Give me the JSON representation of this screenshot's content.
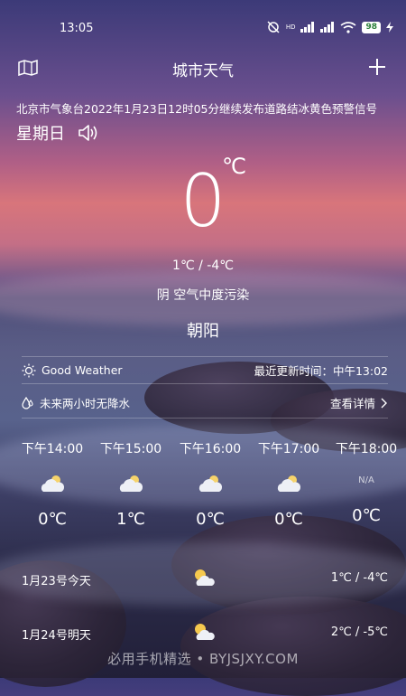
{
  "status_bar": {
    "time": "13:05",
    "network": "HD",
    "battery": "98"
  },
  "nav": {
    "title": "城市天气",
    "map_icon": "map-icon",
    "add_icon": "plus-icon"
  },
  "alert": {
    "text": "北京市气象台2022年1月23日12时05分继续发布道路结冰黄色预警信号"
  },
  "weekday": "星期日",
  "current": {
    "temp": "0",
    "unit": "℃",
    "range": "1℃ / -4℃",
    "condition": "阴  空气中度污染",
    "city": "朝阳"
  },
  "info": {
    "summary": "Good Weather",
    "updated": "最近更新时间：中午13:02",
    "precip": "未来两小时无降水",
    "details": "查看详情"
  },
  "hourly": [
    {
      "time": "下午14:00",
      "icon": "cloud-icon",
      "temp": "0℃"
    },
    {
      "time": "下午15:00",
      "icon": "cloud-icon",
      "temp": "1℃"
    },
    {
      "time": "下午16:00",
      "icon": "cloud-icon",
      "temp": "0℃"
    },
    {
      "time": "下午17:00",
      "icon": "cloud-icon",
      "temp": "0℃"
    },
    {
      "time": "下午18:00",
      "icon": "N/A",
      "temp": "0℃"
    }
  ],
  "daily": [
    {
      "date": "1月23号今天",
      "icon": "partly-cloudy-icon",
      "temp": "1℃ / -4℃"
    },
    {
      "date": "1月24号明天",
      "icon": "partly-cloudy-icon",
      "temp": "2℃ / -5℃"
    }
  ],
  "watermark": "必用手机精选 • BYJSJXY.COM"
}
